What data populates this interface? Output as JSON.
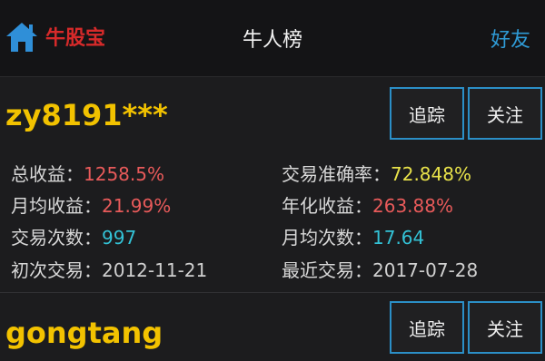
{
  "header": {
    "logo_text": "牛股宝",
    "title": "牛人榜",
    "friends_label": "好友"
  },
  "users": [
    {
      "name": "zy8191***",
      "track_label": "追踪",
      "follow_label": "关注",
      "stats": {
        "total_return_label": "总收益：",
        "total_return": "1258.5%",
        "accuracy_label": "交易准确率：",
        "accuracy": "72.848%",
        "monthly_return_label": "月均收益：",
        "monthly_return": "21.99%",
        "annual_return_label": "年化收益：",
        "annual_return": "263.88%",
        "trades_label": "交易次数：",
        "trades": "997",
        "monthly_trades_label": "月均次数：",
        "monthly_trades": "17.64",
        "first_trade_label": "初次交易：",
        "first_trade": "2012-11-21",
        "last_trade_label": "最近交易：",
        "last_trade": "2017-07-28"
      }
    },
    {
      "name": "gongtang",
      "track_label": "追踪",
      "follow_label": "关注"
    }
  ],
  "colors": {
    "accent": "#2b8fc7",
    "username": "#f2c200",
    "positive": "#e85a5a",
    "highlight": "#e8e24a",
    "cyan": "#33c2d6"
  }
}
